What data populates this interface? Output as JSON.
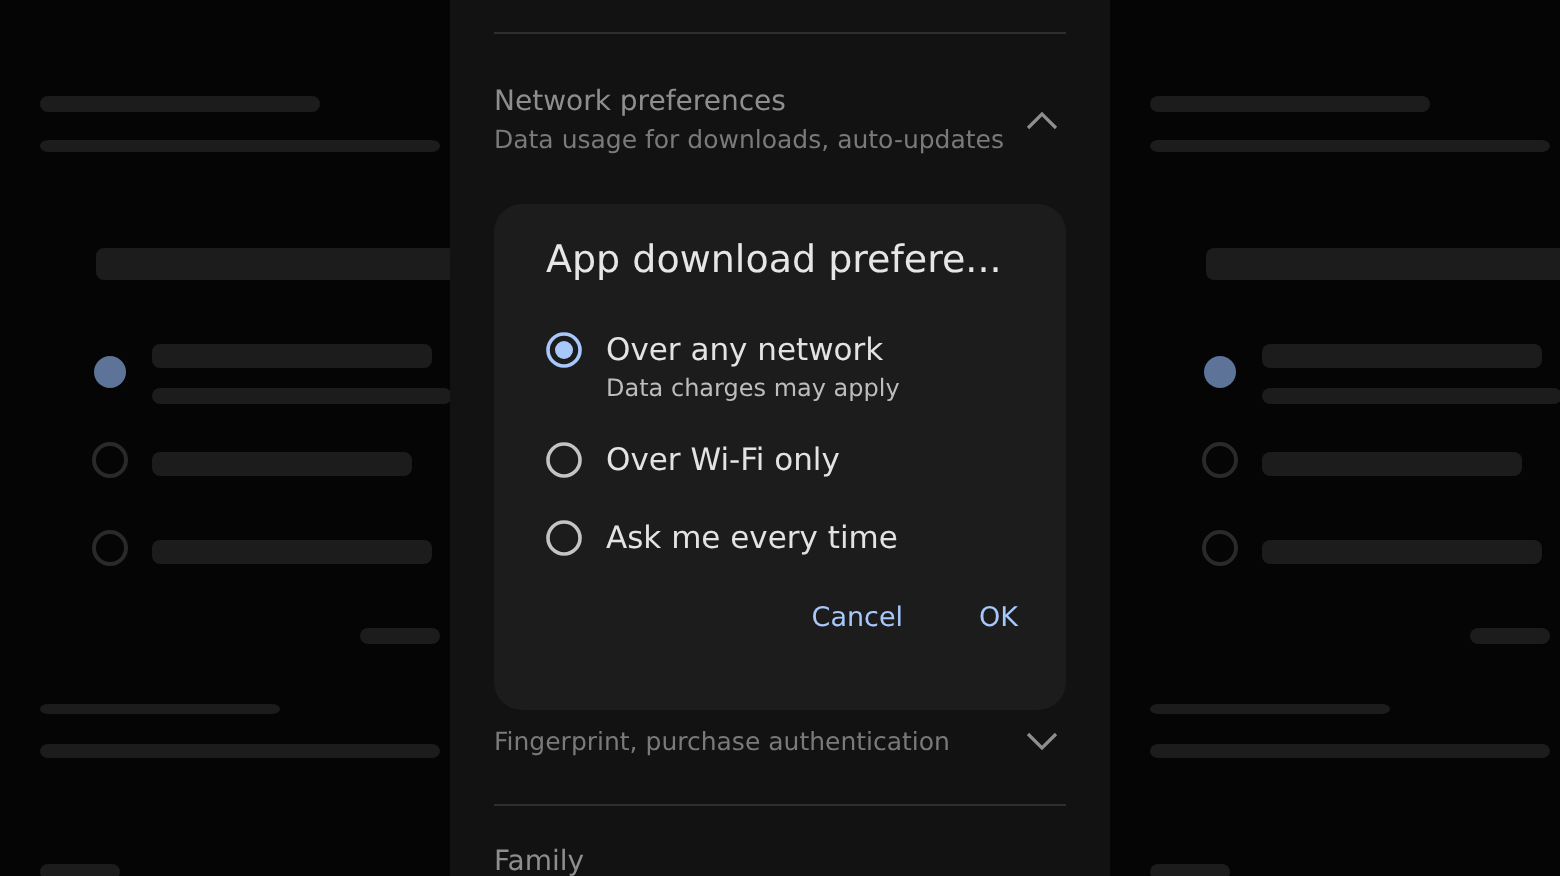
{
  "settings": [
    {
      "title": "Network preferences",
      "subtitle": "Data usage for downloads, auto-updates",
      "expanded": true
    },
    {
      "subtitle": "Fingerprint, purchase authentication",
      "expanded": false
    },
    {
      "title": "Family"
    }
  ],
  "dialog": {
    "title": "App download prefere...",
    "options": [
      {
        "label": "Over any network",
        "hint": "Data charges may apply",
        "selected": true
      },
      {
        "label": "Over Wi-Fi only",
        "selected": false
      },
      {
        "label": "Ask me every time",
        "selected": false
      }
    ],
    "buttons": [
      "Cancel",
      "OK"
    ]
  }
}
